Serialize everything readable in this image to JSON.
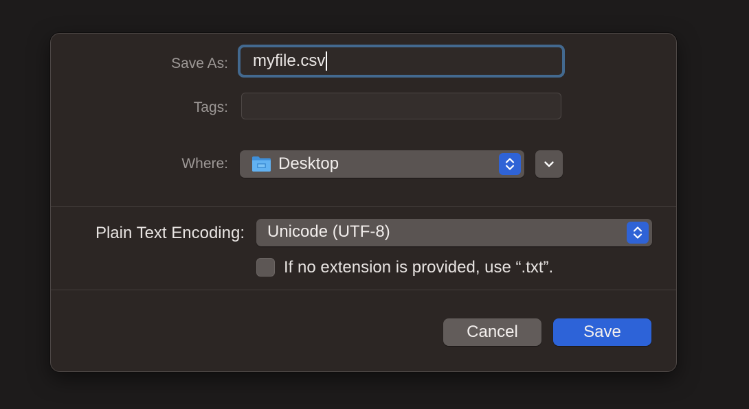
{
  "save_as": {
    "label": "Save As:",
    "value": "myfile.csv"
  },
  "tags": {
    "label": "Tags:",
    "value": ""
  },
  "where": {
    "label": "Where:",
    "selected": "Desktop",
    "folder_icon": "folder-icon",
    "expand_icon": "chevron-down-icon"
  },
  "encoding": {
    "label": "Plain Text Encoding:",
    "selected": "Unicode (UTF-8)"
  },
  "extension_option": {
    "label": "If no extension is provided, use “.txt”.",
    "checked": false
  },
  "buttons": {
    "cancel": "Cancel",
    "save": "Save"
  },
  "colors": {
    "accent": "#2f63d6",
    "save_button": "#2d63d8",
    "focus_ring": "#43698f",
    "dialog_bg": "#2c2624"
  }
}
